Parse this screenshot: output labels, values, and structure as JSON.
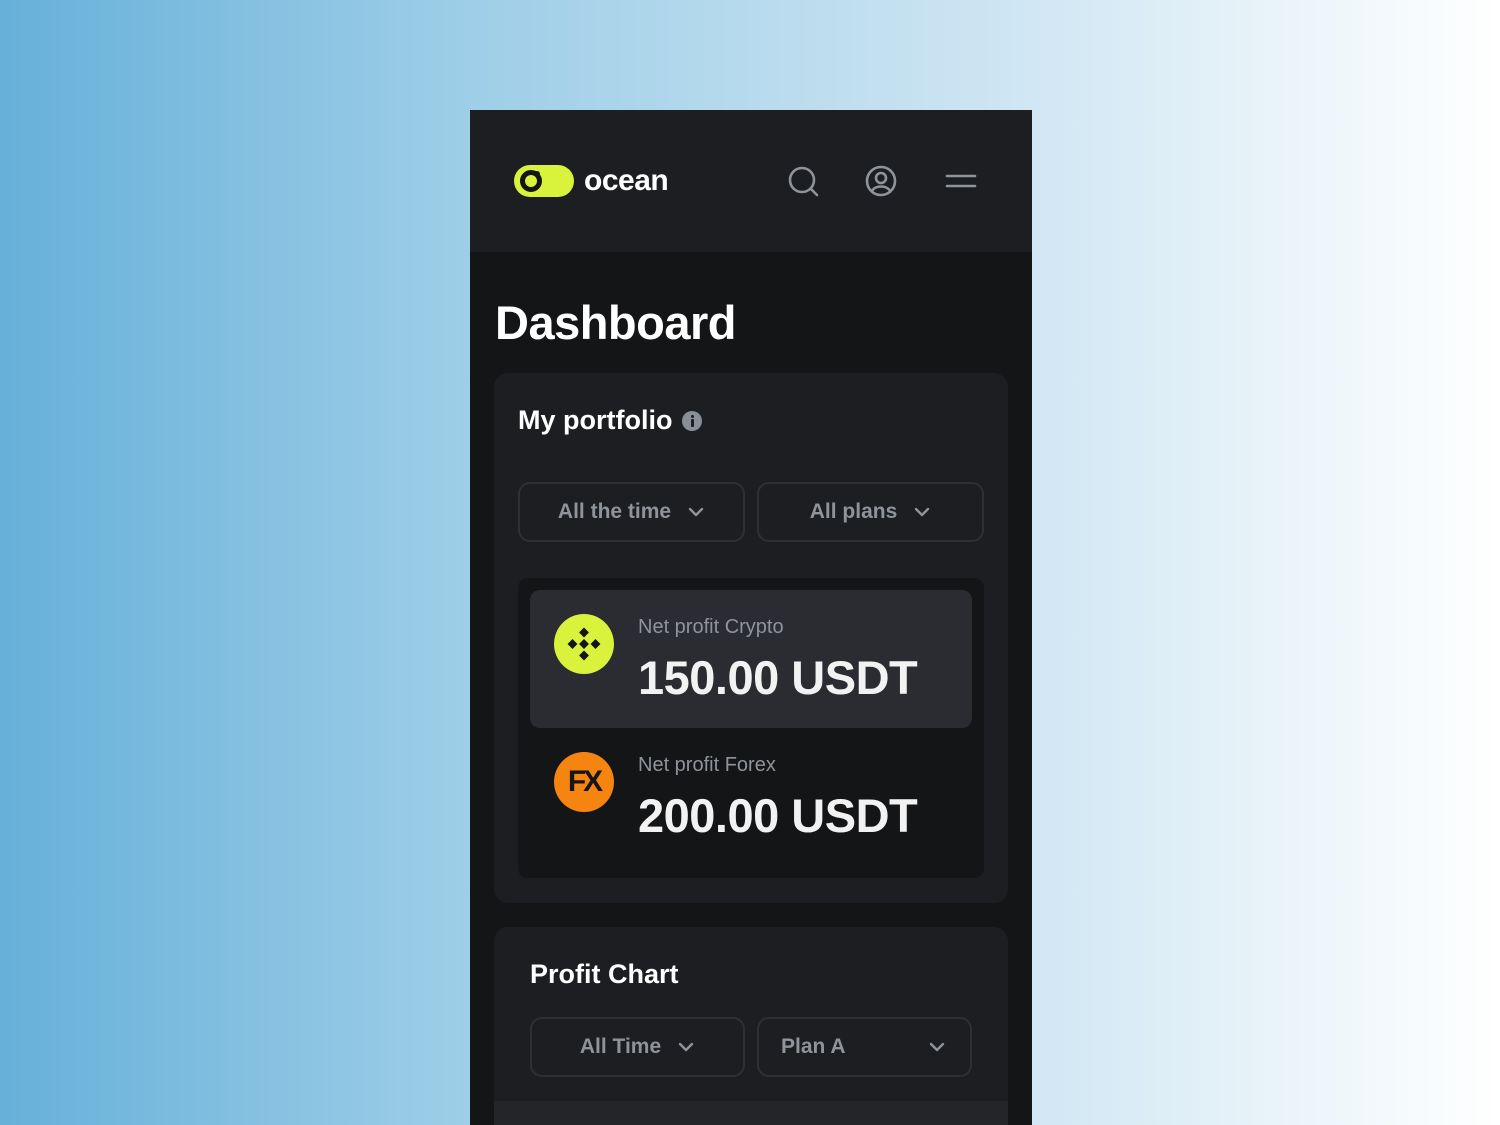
{
  "app": {
    "brand": "ocean"
  },
  "header": {
    "icons": [
      "search-icon",
      "user-circle-icon",
      "menu-icon"
    ]
  },
  "page": {
    "title": "Dashboard"
  },
  "portfolio": {
    "title": "My portfolio",
    "filters": {
      "period": "All the time",
      "plan": "All plans"
    },
    "items": [
      {
        "label": "Net profit Crypto",
        "value": "150.00 USDT",
        "icon": "binance-coin-icon",
        "color": "#d9f23c"
      },
      {
        "label": "Net profit Forex",
        "value": "200.00 USDT",
        "icon_text": "FX",
        "color": "#f58410"
      }
    ]
  },
  "profit_chart": {
    "title": "Profit Chart",
    "filters": {
      "period": "All Time",
      "plan": "Plan A"
    }
  },
  "colors": {
    "accent": "#d9f23c",
    "forex": "#f58410",
    "surface": "#1c1e21",
    "background": "#141517"
  }
}
